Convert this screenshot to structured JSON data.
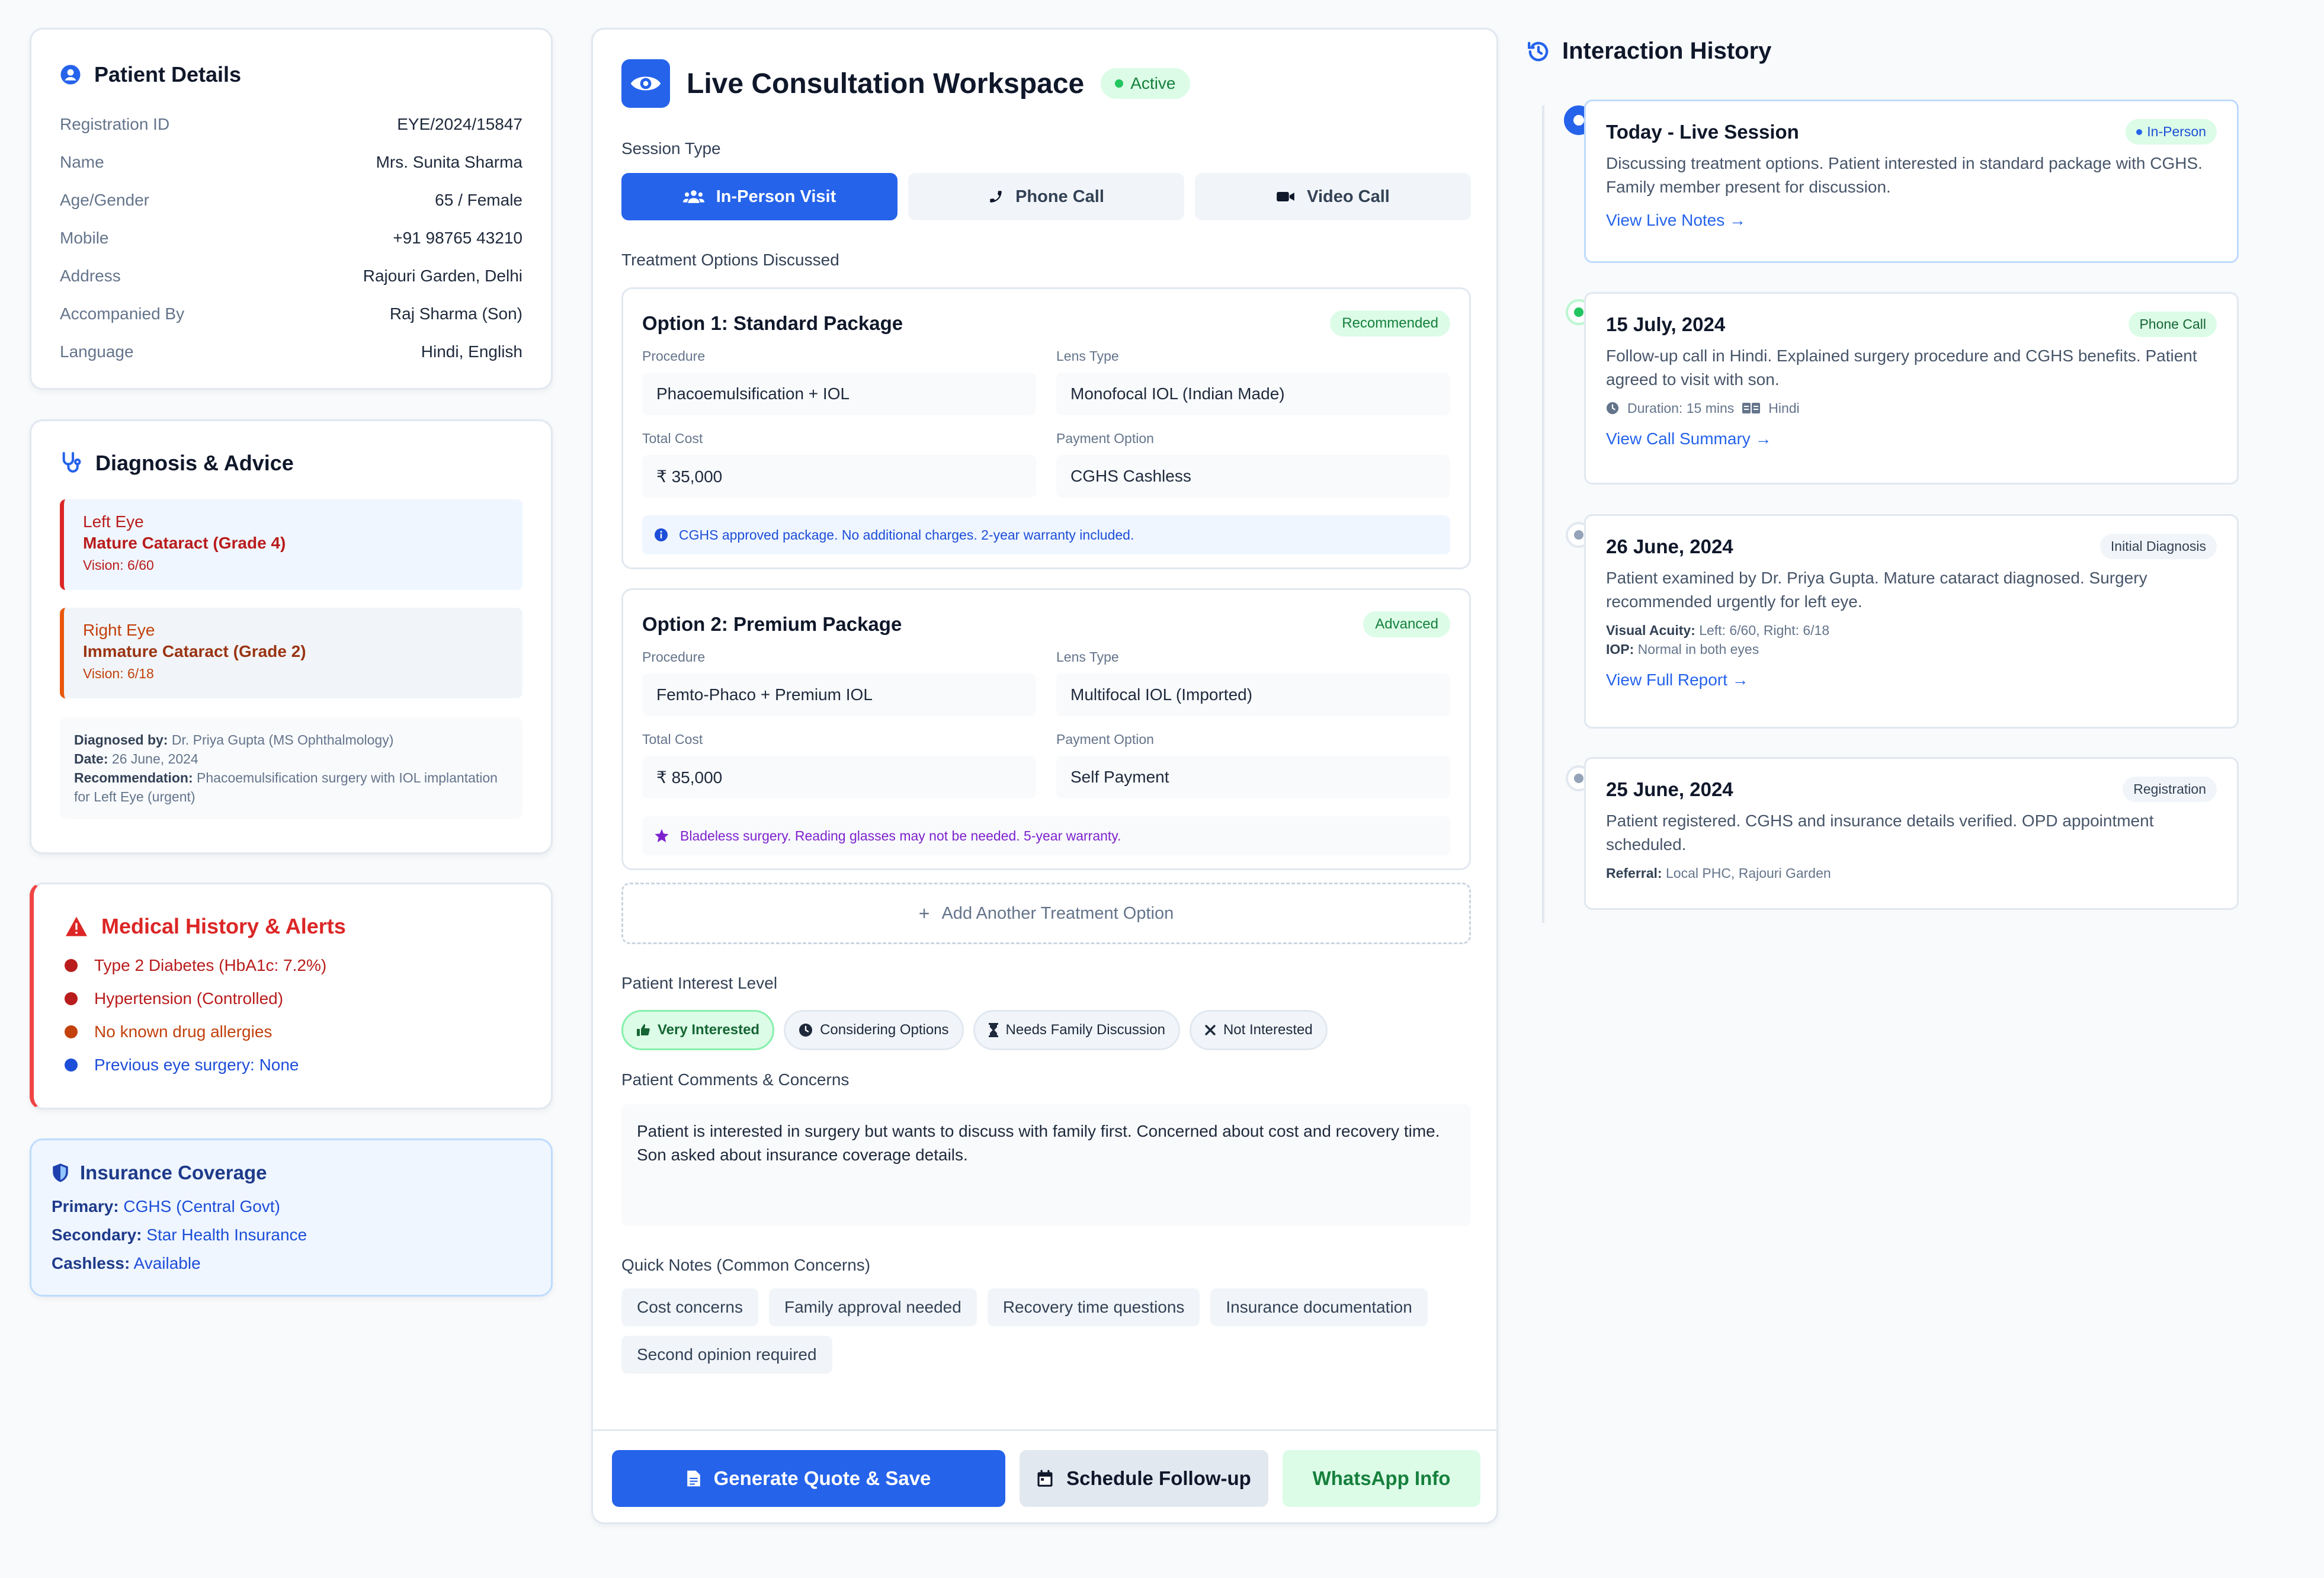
{
  "patient": {
    "title": "Patient Details",
    "fields": [
      {
        "label": "Registration ID",
        "value": "EYE/2024/15847"
      },
      {
        "label": "Name",
        "value": "Mrs. Sunita Sharma"
      },
      {
        "label": "Age/Gender",
        "value": "65 / Female"
      },
      {
        "label": "Mobile",
        "value": "+91 98765 43210"
      },
      {
        "label": "Address",
        "value": "Rajouri Garden, Delhi"
      },
      {
        "label": "Accompanied By",
        "value": "Raj Sharma (Son)"
      },
      {
        "label": "Language",
        "value": "Hindi, English"
      }
    ]
  },
  "diagnosis": {
    "title": "Diagnosis & Advice",
    "left_eye": {
      "side": "Left Eye",
      "diagnosis": "Mature Cataract (Grade 4)",
      "vision": "Vision: 6/60"
    },
    "right_eye": {
      "side": "Right Eye",
      "diagnosis": "Immature Cataract (Grade 2)",
      "vision": "Vision: 6/18"
    },
    "diagnosed_by_label": "Diagnosed by:",
    "diagnosed_by": "Dr. Priya Gupta (MS Ophthalmology)",
    "date_label": "Date:",
    "date": "26 June, 2024",
    "recommendation_label": "Recommendation:",
    "recommendation": "Phacoemulsification surgery with IOL implantation for Left Eye (urgent)"
  },
  "alerts": {
    "title": "Medical History & Alerts",
    "items": [
      {
        "text": "Type 2 Diabetes (HbA1c: 7.2%)",
        "color": "#b91c1c",
        "dot": "#b91c1c"
      },
      {
        "text": "Hypertension (Controlled)",
        "color": "#b91c1c",
        "dot": "#b91c1c"
      },
      {
        "text": "No known drug allergies",
        "color": "#c2410c",
        "dot": "#c2410c"
      },
      {
        "text": "Previous eye surgery: None",
        "color": "#1d4ed8",
        "dot": "#1d4ed8"
      }
    ]
  },
  "insurance": {
    "title": "Insurance Coverage",
    "primary_label": "Primary:",
    "primary": "CGHS (Central Govt)",
    "secondary_label": "Secondary:",
    "secondary": "Star Health Insurance",
    "cashless_label": "Cashless:",
    "cashless": "Available"
  },
  "workspace": {
    "title": "Live Consultation Workspace",
    "status": "Active",
    "session_type_label": "Session Type",
    "session_types": [
      {
        "label": "In-Person Visit",
        "icon": "users-icon",
        "active": true
      },
      {
        "label": "Phone Call",
        "icon": "phone-icon",
        "active": false
      },
      {
        "label": "Video Call",
        "icon": "video-icon",
        "active": false
      }
    ],
    "treatment_label": "Treatment Options Discussed",
    "options": [
      {
        "title": "Option 1: Standard Package",
        "badge": "Recommended",
        "procedure_label": "Procedure",
        "procedure": "Phacoemulsification + IOL",
        "lens_label": "Lens Type",
        "lens": "Monofocal IOL (Indian Made)",
        "cost_label": "Total Cost",
        "cost": "₹ 35,000",
        "payment_label": "Payment Option",
        "payment": "CGHS Cashless",
        "note": "CGHS approved package. No additional charges. 2-year warranty included."
      },
      {
        "title": "Option 2: Premium Package",
        "badge": "Advanced",
        "procedure_label": "Procedure",
        "procedure": "Femto-Phaco + Premium IOL",
        "lens_label": "Lens Type",
        "lens": "Multifocal IOL (Imported)",
        "cost_label": "Total Cost",
        "cost": "₹ 85,000",
        "payment_label": "Payment Option",
        "payment": "Self Payment",
        "note": "Bladeless surgery. Reading glasses may not be needed. 5-year warranty."
      }
    ],
    "add_option": "Add Another Treatment Option",
    "interest_label": "Patient Interest Level",
    "interest_levels": [
      {
        "label": "Very Interested",
        "active": true
      },
      {
        "label": "Considering Options",
        "active": false
      },
      {
        "label": "Needs Family Discussion",
        "active": false
      },
      {
        "label": "Not Interested",
        "active": false
      }
    ],
    "comments_label": "Patient Comments & Concerns",
    "comments": "Patient is interested in surgery but wants to discuss with family first. Concerned about cost and recovery time. Son asked about insurance coverage details.",
    "quick_notes_label": "Quick Notes (Common Concerns)",
    "quick_notes": [
      "Cost concerns",
      "Family approval needed",
      "Recovery time questions",
      "Insurance documentation",
      "Second opinion required"
    ],
    "actions": {
      "generate": "Generate Quote & Save",
      "schedule": "Schedule Follow-up",
      "whatsapp": "WhatsApp Info"
    }
  },
  "history": {
    "title": "Interaction History",
    "items": [
      {
        "date": "Today - Live Session",
        "tag": "In-Person",
        "text": "Discussing treatment options. Patient interested in standard package with CGHS. Family member present for discussion.",
        "link": "View Live Notes →"
      },
      {
        "date": "15 July, 2024",
        "tag": "Phone Call",
        "text": "Follow-up call in Hindi. Explained surgery procedure and CGHS benefits. Patient agreed to visit with son.",
        "duration": "Duration: 15 mins",
        "language": "Hindi",
        "link": "View Call Summary →"
      },
      {
        "date": "26 June, 2024",
        "tag": "Initial Diagnosis",
        "text": "Patient examined by Dr. Priya Gupta. Mature cataract diagnosed. Surgery recommended urgently for left eye.",
        "acuity_label": "Visual Acuity:",
        "acuity": "Left: 6/60, Right: 6/18",
        "iop_label": "IOP:",
        "iop": "Normal in both eyes",
        "link": "View Full Report →"
      },
      {
        "date": "25 June, 2024",
        "tag": "Registration",
        "text": "Patient registered. CGHS and insurance details verified. OPD appointment scheduled.",
        "referral_label": "Referral:",
        "referral": "Local PHC, Rajouri Garden"
      }
    ]
  }
}
